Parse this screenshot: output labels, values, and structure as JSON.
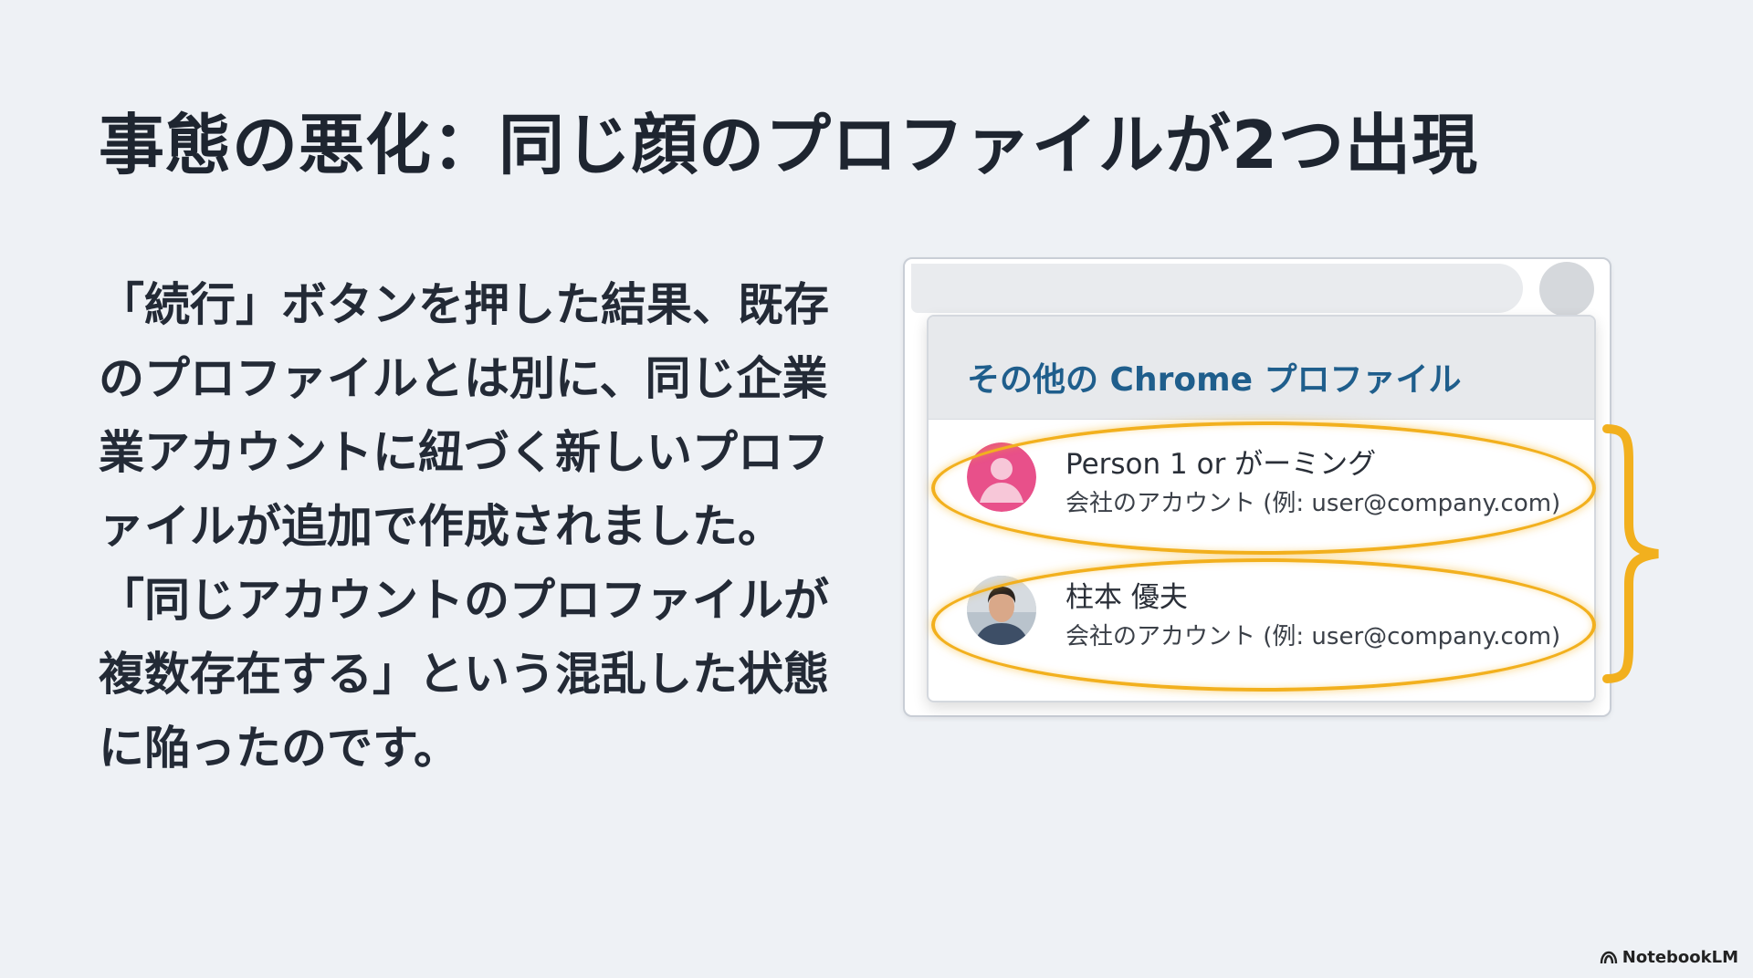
{
  "slide": {
    "title": "事態の悪化：同じ顔のプロファイルが2つ出現",
    "body_lines": [
      "「続行」ボタンを押した結果、既存",
      "のプロファイルとは別に、同じ企業",
      "業アカウントに紐づく新しいプロフ",
      "ァイルが追加で作成されました。",
      "「同じアカウントのプロファイルが",
      "複数存在する」という混乱した状態",
      "に陥ったのです。"
    ]
  },
  "profile_menu": {
    "header": "その他の Chrome プロファイル",
    "profiles": [
      {
        "name": "Person 1 or がーミング",
        "email": "会社のアカウント (例: user@company.com)",
        "avatar": "pink-person-avatar"
      },
      {
        "name": "柱本 優夫",
        "email": "会社のアカウント (例: user@company.com)",
        "avatar": "photo-avatar"
      }
    ]
  },
  "colors": {
    "background": "#eef1f5",
    "header_text": "#1f5e8c",
    "highlight": "#f2b01e",
    "avatar_pink": "#e8508a"
  },
  "watermark": {
    "label": "NotebookLM",
    "icon": "notebooklm-logo-icon"
  }
}
